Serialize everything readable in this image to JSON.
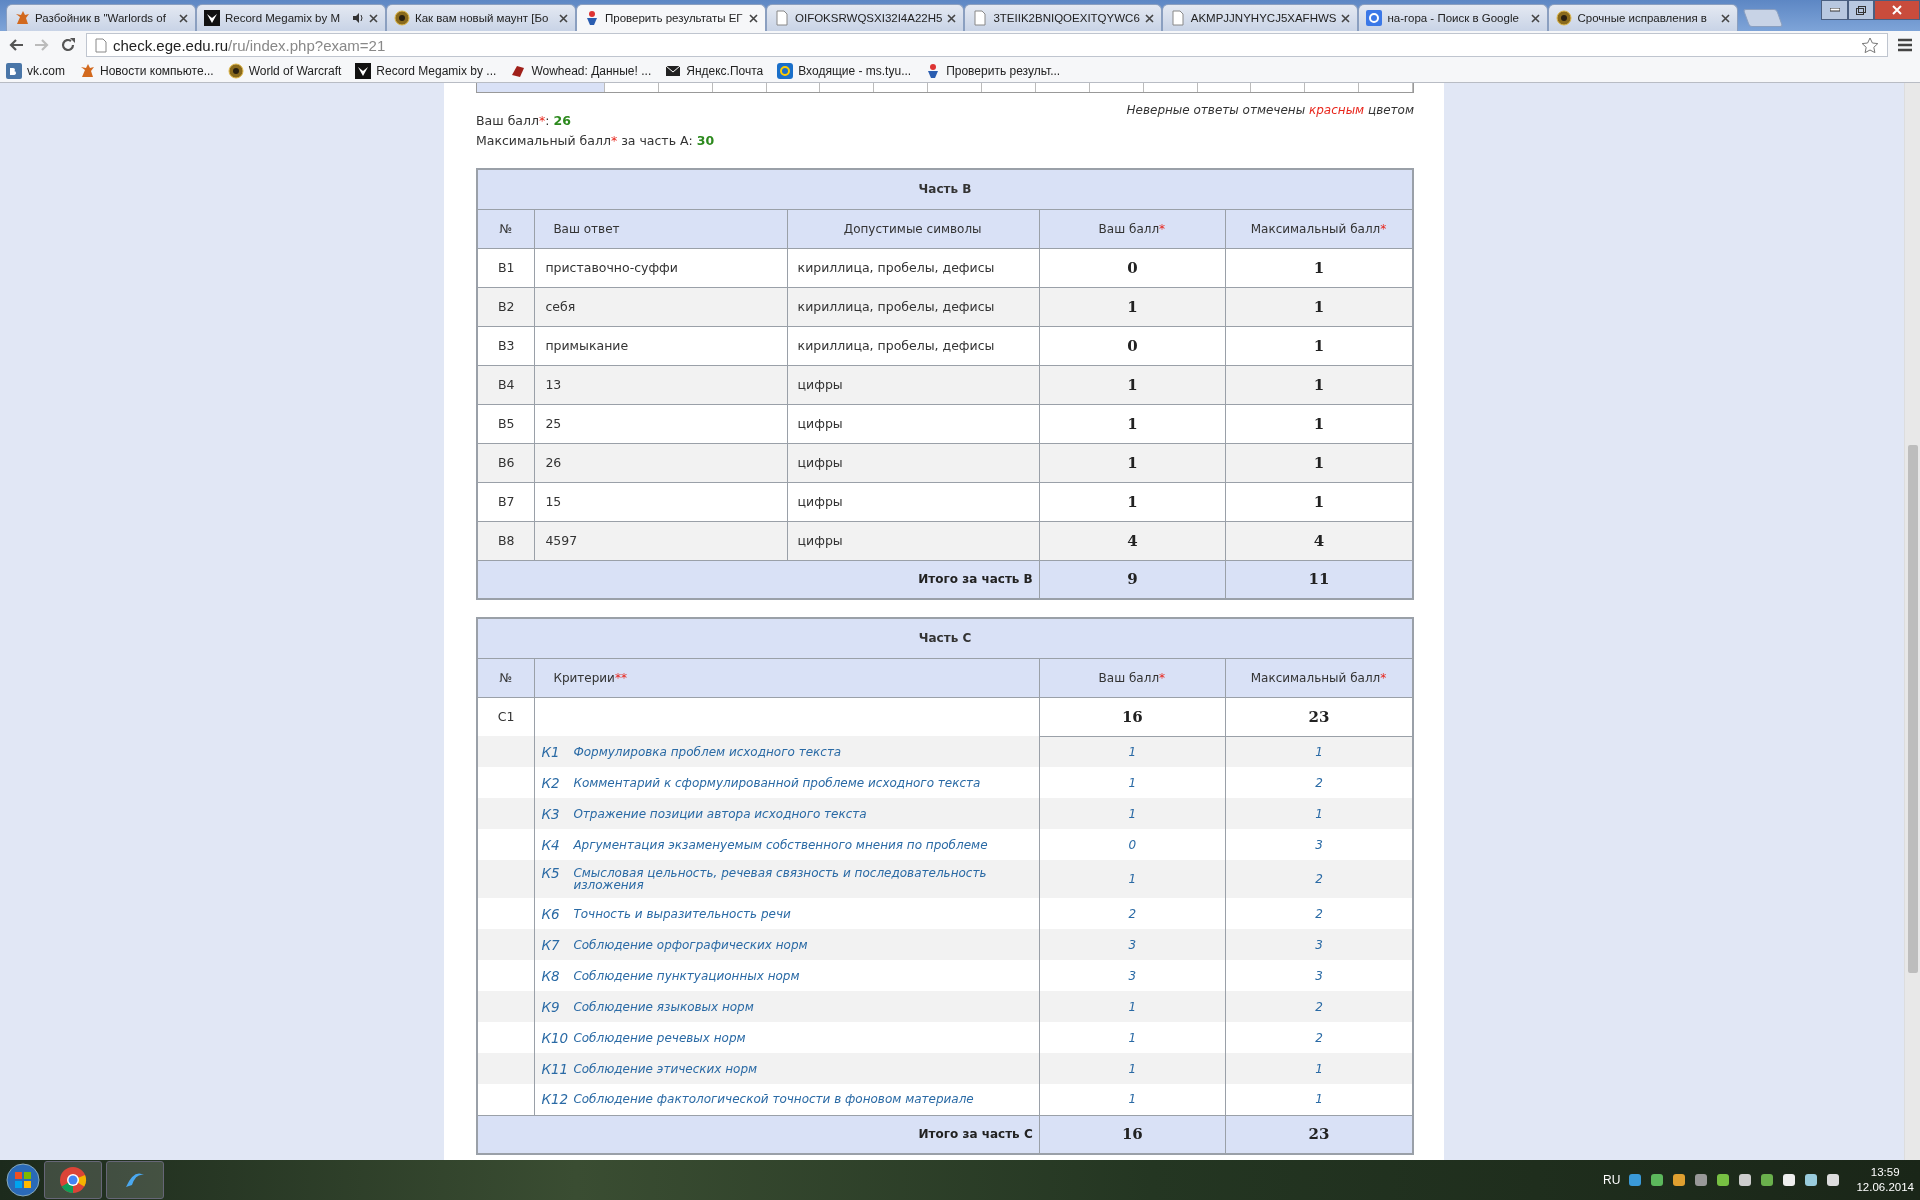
{
  "browser": {
    "tabs": [
      {
        "title": "Разбойник в \"Warlords of",
        "kind": "creature",
        "selected": false,
        "audio": false
      },
      {
        "title": "Record Megamix by M",
        "kind": "megamix",
        "selected": false,
        "audio": true
      },
      {
        "title": "Как вам новый маунт [Бо",
        "kind": "wow",
        "selected": false,
        "audio": false
      },
      {
        "title": "Проверить результаты ЕГ",
        "kind": "ege",
        "selected": true,
        "audio": false
      },
      {
        "title": "OIFOKSRWQSXI32I4A22H5",
        "kind": "doc",
        "selected": false,
        "audio": false
      },
      {
        "title": "3TEIIK2BNIQOEXITQYWC6",
        "kind": "doc",
        "selected": false,
        "audio": false
      },
      {
        "title": "AKMPJJNYHYCJ5XAFHWS",
        "kind": "doc",
        "selected": false,
        "audio": false
      },
      {
        "title": "на-гора - Поиск в Google",
        "kind": "google",
        "selected": false,
        "audio": false
      },
      {
        "title": "Срочные исправления в",
        "kind": "wow",
        "selected": false,
        "audio": false
      }
    ],
    "address": {
      "host": "check.ege.edu.ru",
      "path": "/ru/index.php?exam=21"
    },
    "bookmarks": [
      {
        "label": "vk.com",
        "kind": "vk"
      },
      {
        "label": "Новости компьюте...",
        "kind": "creature"
      },
      {
        "label": "World of Warcraft",
        "kind": "wow"
      },
      {
        "label": "Record Megamix by ...",
        "kind": "megamix"
      },
      {
        "label": "Wowhead: Данные! ...",
        "kind": "wowhead"
      },
      {
        "label": "Яндекс.Почта",
        "kind": "mail"
      },
      {
        "label": "Входящие - ms.tyu...",
        "kind": "mailru"
      },
      {
        "label": "Проверить результ...",
        "kind": "ege"
      }
    ]
  },
  "page": {
    "note": {
      "before": "Неверные ответы отмечены ",
      "highlight": "красным",
      "after": " цветом"
    },
    "scores": [
      {
        "label": "Ваш балл",
        "asterisk": "*",
        "rest": ": ",
        "value": "26"
      },
      {
        "label": "Максимальный балл",
        "asterisk": "*",
        "rest": " за часть А: ",
        "value": "30"
      }
    ],
    "part_b": {
      "title": "Часть В",
      "columns": [
        {
          "label": "№"
        },
        {
          "label": "Ваш ответ"
        },
        {
          "label": "Допустимые символы"
        },
        {
          "label": "Ваш балл",
          "asterisk": "*"
        },
        {
          "label": "Максимальный балл",
          "asterisk": "*"
        }
      ],
      "rows": [
        {
          "num": "В1",
          "answer": "приставочно-суффи",
          "symbols": "кириллица, пробелы, дефисы",
          "score": "0",
          "max": "1"
        },
        {
          "num": "В2",
          "answer": "себя",
          "symbols": "кириллица, пробелы, дефисы",
          "score": "1",
          "max": "1"
        },
        {
          "num": "В3",
          "answer": "примыкание",
          "symbols": "кириллица, пробелы, дефисы",
          "score": "0",
          "max": "1"
        },
        {
          "num": "В4",
          "answer": "13",
          "symbols": "цифры",
          "score": "1",
          "max": "1"
        },
        {
          "num": "В5",
          "answer": "25",
          "symbols": "цифры",
          "score": "1",
          "max": "1"
        },
        {
          "num": "В6",
          "answer": "26",
          "symbols": "цифры",
          "score": "1",
          "max": "1"
        },
        {
          "num": "В7",
          "answer": "15",
          "symbols": "цифры",
          "score": "1",
          "max": "1"
        },
        {
          "num": "В8",
          "answer": "4597",
          "symbols": "цифры",
          "score": "4",
          "max": "4"
        }
      ],
      "total": {
        "label": "Итого за часть В",
        "score": "9",
        "max": "11"
      }
    },
    "part_c": {
      "title": "Часть С",
      "columns": [
        {
          "label": "№"
        },
        {
          "label": "Критерии",
          "asterisk": "**"
        },
        {
          "label": "Ваш балл",
          "asterisk": "*"
        },
        {
          "label": "Максимальный балл",
          "asterisk": "*"
        }
      ],
      "task": {
        "num": "С1",
        "score": "16",
        "max": "23"
      },
      "criteria": [
        {
          "code": "К1",
          "text": "Формулировка проблем исходного текста",
          "score": "1",
          "max": "1"
        },
        {
          "code": "К2",
          "text": "Комментарий к сформулированной проблеме исходного текста",
          "score": "1",
          "max": "2"
        },
        {
          "code": "К3",
          "text": "Отражение позиции автора исходного текста",
          "score": "1",
          "max": "1"
        },
        {
          "code": "К4",
          "text": "Аргументация экзаменуемым собственного мнения по проблеме",
          "score": "0",
          "max": "3"
        },
        {
          "code": "К5",
          "text": "Смысловая цельность, речевая связность и последовательность изложения",
          "score": "1",
          "max": "2"
        },
        {
          "code": "К6",
          "text": "Точность и выразительность речи",
          "score": "2",
          "max": "2"
        },
        {
          "code": "К7",
          "text": "Соблюдение орфографических норм",
          "score": "3",
          "max": "3"
        },
        {
          "code": "К8",
          "text": "Соблюдение пунктуационных норм",
          "score": "3",
          "max": "3"
        },
        {
          "code": "К9",
          "text": "Соблюдение языковых норм",
          "score": "1",
          "max": "2"
        },
        {
          "code": "К10",
          "text": "Соблюдение речевых норм",
          "score": "1",
          "max": "2"
        },
        {
          "code": "К11",
          "text": "Соблюдение этических норм",
          "score": "1",
          "max": "1"
        },
        {
          "code": "К12",
          "text": "Соблюдение фактологической точности в фоновом материале",
          "score": "1",
          "max": "1"
        }
      ],
      "total": {
        "label": "Итого за часть С",
        "score": "16",
        "max": "23"
      }
    }
  },
  "taskbar": {
    "language": "RU",
    "time": "13:59",
    "date": "12.06.2014"
  }
}
